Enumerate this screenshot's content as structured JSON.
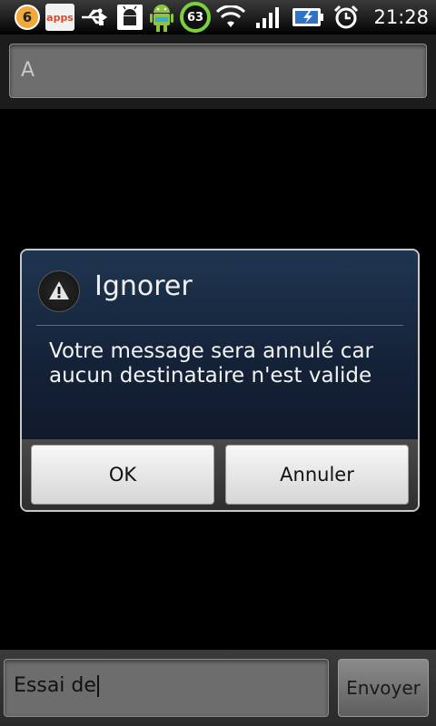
{
  "status_bar": {
    "notif_count": "6",
    "apps_label": "apps",
    "battery_level": "63",
    "time": "21:28",
    "icons": [
      "badge-icon",
      "apps-icon",
      "usb-icon",
      "android-debug-icon",
      "android-icon",
      "gauge-icon",
      "wifi-icon",
      "signal-icon",
      "battery-charging-icon",
      "alarm-icon"
    ]
  },
  "to_field": {
    "value": "A"
  },
  "dialog": {
    "title": "Ignorer",
    "message": "Votre message sera annulé car aucun destinataire n'est valide",
    "ok_label": "OK",
    "cancel_label": "Annuler",
    "icon": "warning-icon"
  },
  "compose": {
    "text": "Essai de",
    "send_label": "Envoyer"
  },
  "colors": {
    "dialog_bg": "#1f3550",
    "button_bg": "#e8e8e8",
    "gauge_green": "#7bd13a"
  }
}
